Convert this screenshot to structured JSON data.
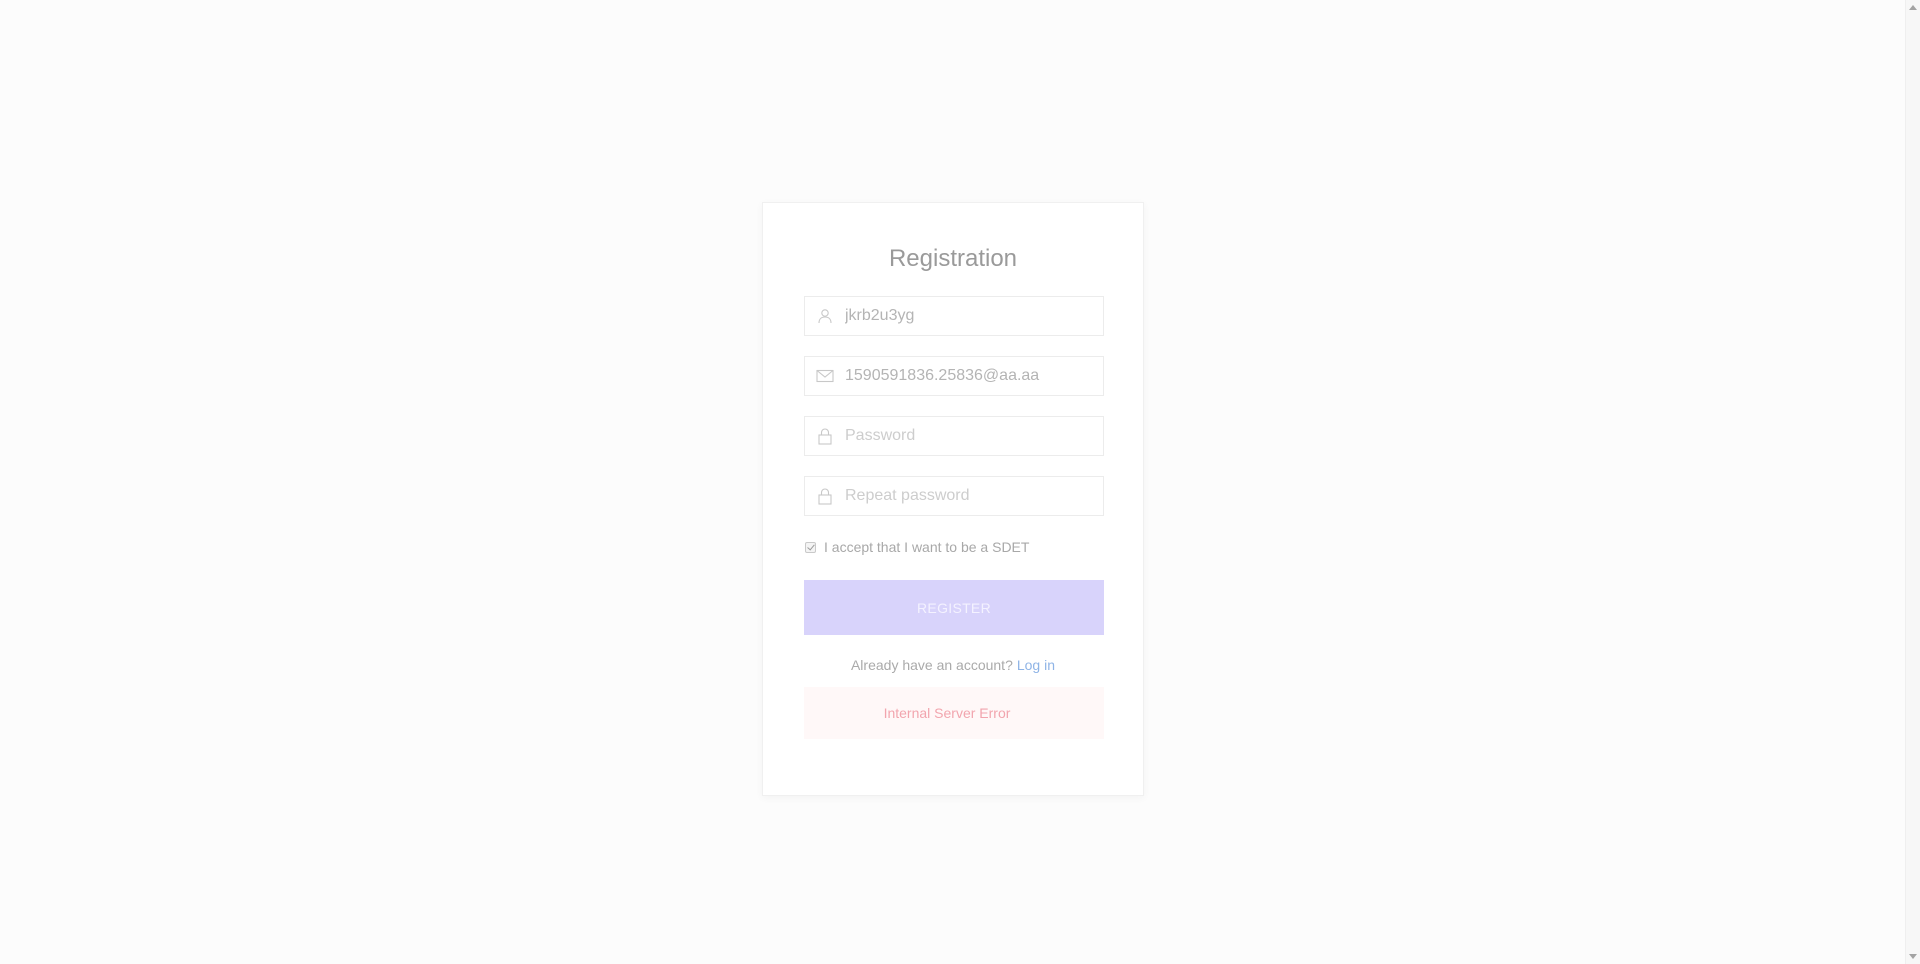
{
  "form": {
    "title": "Registration",
    "username": {
      "value": "jkrb2u3yg",
      "icon": "user-icon"
    },
    "email": {
      "value": "1590591836.25836@aa.aa",
      "icon": "envelope-icon"
    },
    "password": {
      "placeholder": "Password",
      "value": "",
      "icon": "lock-icon"
    },
    "repeat_password": {
      "placeholder": "Repeat password",
      "value": "",
      "icon": "lock-icon"
    },
    "accept_label": "I accept that I want to be a SDET",
    "accept_checked": true,
    "register_label": "REGISTER",
    "already_text": "Already have an account?",
    "login_link": "Log in",
    "error_message": "Internal Server Error"
  },
  "colors": {
    "button_bg": "#d8d3fb",
    "link": "#8fb4e6",
    "error_text": "#f2a5ae",
    "error_bg": "#fff8f8"
  }
}
